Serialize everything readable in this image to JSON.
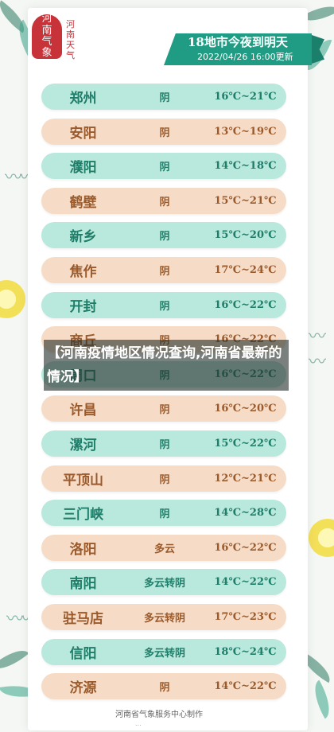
{
  "logo": {
    "seal_chars": [
      "河",
      "南",
      "气",
      "象"
    ],
    "brand": "河南天气"
  },
  "header": {
    "title": "18地市今夜到明天",
    "datetime": "2022/04/26 16:00更新"
  },
  "rows": [
    {
      "city": "郑州",
      "weather": "阴",
      "temp": "16℃~21℃",
      "style": "teal"
    },
    {
      "city": "安阳",
      "weather": "阴",
      "temp": "13℃~19℃",
      "style": "peach"
    },
    {
      "city": "濮阳",
      "weather": "阴",
      "temp": "14℃~18℃",
      "style": "teal"
    },
    {
      "city": "鹤壁",
      "weather": "阴",
      "temp": "15℃~21℃",
      "style": "peach"
    },
    {
      "city": "新乡",
      "weather": "阴",
      "temp": "15℃~20℃",
      "style": "teal"
    },
    {
      "city": "焦作",
      "weather": "阴",
      "temp": "17℃~24℃",
      "style": "peach"
    },
    {
      "city": "开封",
      "weather": "阴",
      "temp": "16℃~22℃",
      "style": "teal"
    },
    {
      "city": "商丘",
      "weather": "阴",
      "temp": "16℃~22℃",
      "style": "peach"
    },
    {
      "city": "周口",
      "weather": "阴",
      "temp": "16℃~22℃",
      "style": "teal"
    },
    {
      "city": "许昌",
      "weather": "阴",
      "temp": "16℃~20℃",
      "style": "peach"
    },
    {
      "city": "漯河",
      "weather": "阴",
      "temp": "15℃~22℃",
      "style": "teal"
    },
    {
      "city": "平顶山",
      "weather": "阴",
      "temp": "12℃~21℃",
      "style": "peach"
    },
    {
      "city": "三门峡",
      "weather": "阴",
      "temp": "14℃~28℃",
      "style": "teal"
    },
    {
      "city": "洛阳",
      "weather": "多云",
      "temp": "16℃~22℃",
      "style": "peach"
    },
    {
      "city": "南阳",
      "weather": "多云转阴",
      "temp": "14℃~22℃",
      "style": "teal"
    },
    {
      "city": "驻马店",
      "weather": "多云转阴",
      "temp": "17℃~23℃",
      "style": "peach"
    },
    {
      "city": "信阳",
      "weather": "多云转阴",
      "temp": "18℃~24℃",
      "style": "teal"
    },
    {
      "city": "济源",
      "weather": "阴",
      "temp": "14℃~22℃",
      "style": "peach"
    }
  ],
  "overlay_caption": "【河南疫情地区情况查询,河南省最新的情况】",
  "footer": {
    "credit": "河南省气象服务中心制作",
    "sub": "..."
  }
}
